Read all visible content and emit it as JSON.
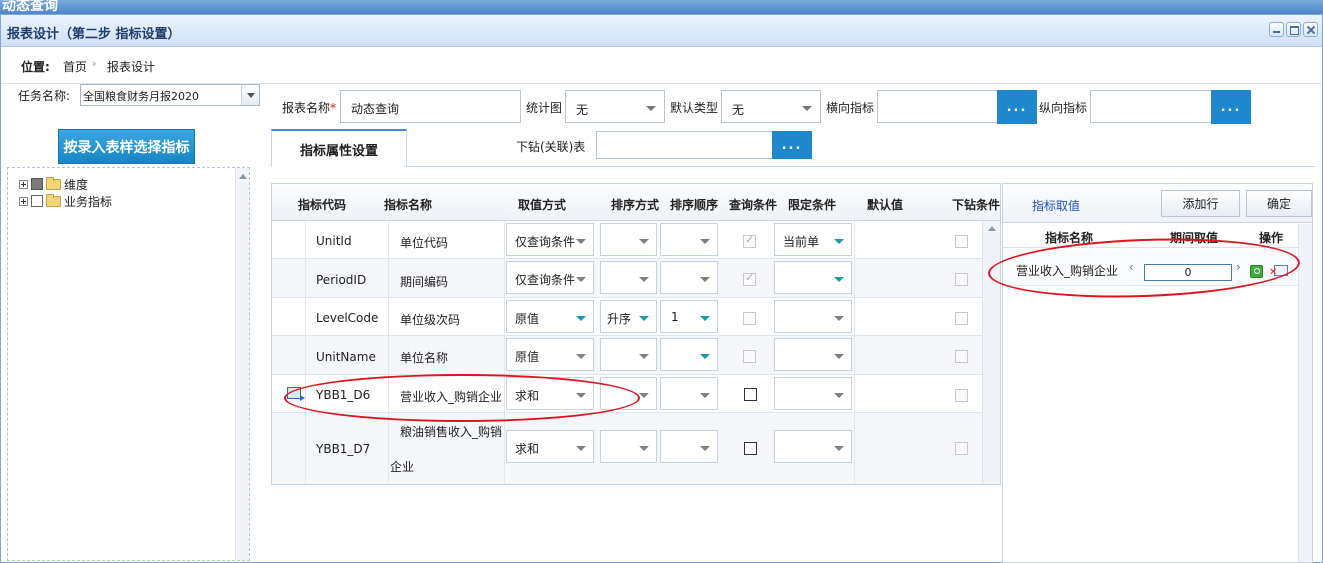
{
  "outer_title": "动态查询",
  "window": {
    "title": "报表设计（第二步 指标设置）"
  },
  "breadcrumb": {
    "label": "位置:",
    "home": "首页",
    "separator": "›",
    "current": "报表设计"
  },
  "task": {
    "label": "任务名称:",
    "value": "全国粮食财务月报2020"
  },
  "entry_button": "按录入表样选择指标",
  "tree": {
    "items": [
      {
        "label": "维度",
        "state": "partial"
      },
      {
        "label": "业务指标",
        "state": "unchecked"
      }
    ]
  },
  "form": {
    "report_name_label": "报表名称",
    "required_mark": "*",
    "report_name_value": "动态查询",
    "chart_label": "统计图",
    "chart_value": "无",
    "default_type_label": "默认类型",
    "default_type_value": "无",
    "horizontal_label": "横向指标",
    "vertical_label": "纵向指标",
    "drill_label": "下钻(关联)表",
    "dots": "..."
  },
  "tab": {
    "label": "指标属性设置"
  },
  "grid": {
    "headers": [
      "指标代码",
      "指标名称",
      "取值方式",
      "排序方式",
      "排序顺序",
      "查询条件",
      "限定条件",
      "默认值",
      "下钻条件"
    ],
    "rows": [
      {
        "code": "UnitId",
        "name": "单位代码",
        "mode": "仅查询条件",
        "sort": "",
        "order": "",
        "query": "checked-disabled",
        "limit": "当前单",
        "limit_teal": true
      },
      {
        "code": "PeriodID",
        "name": "期间编码",
        "mode": "仅查询条件",
        "sort": "",
        "order": "",
        "query": "checked-disabled",
        "limit": "",
        "limit_teal": true
      },
      {
        "code": "LevelCode",
        "name": "单位级次码",
        "mode": "原值",
        "sort": "升序",
        "order": "1",
        "query": "disabled",
        "limit": "",
        "limit_teal": false
      },
      {
        "code": "UnitName",
        "name": "单位名称",
        "mode": "原值",
        "sort": "",
        "order": "",
        "query": "disabled",
        "limit": "",
        "limit_teal": false
      },
      {
        "code": "YBB1_D6",
        "name": "营业收入_购销企业",
        "mode": "求和",
        "sort": "",
        "order": "",
        "query": "unchecked",
        "limit": "",
        "limit_teal": false
      },
      {
        "code": "YBB1_D7",
        "name_line1": "粮油销售收入_购销",
        "name_line2": "企业",
        "mode": "求和",
        "sort": "",
        "order": "",
        "query": "unchecked",
        "limit": "",
        "limit_teal": false
      }
    ]
  },
  "right_panel": {
    "link": "指标取值",
    "add_button": "添加行",
    "ok_button": "确定",
    "headers": [
      "指标名称",
      "期间取值",
      "操作"
    ],
    "row": {
      "name": "营业收入_购销企业",
      "value": "0",
      "prev": "‹",
      "next": "›"
    }
  },
  "colors": {
    "accent": "#1f88cc",
    "annotation": "#e0141e",
    "teal_arrow": "#1b9aaa"
  }
}
